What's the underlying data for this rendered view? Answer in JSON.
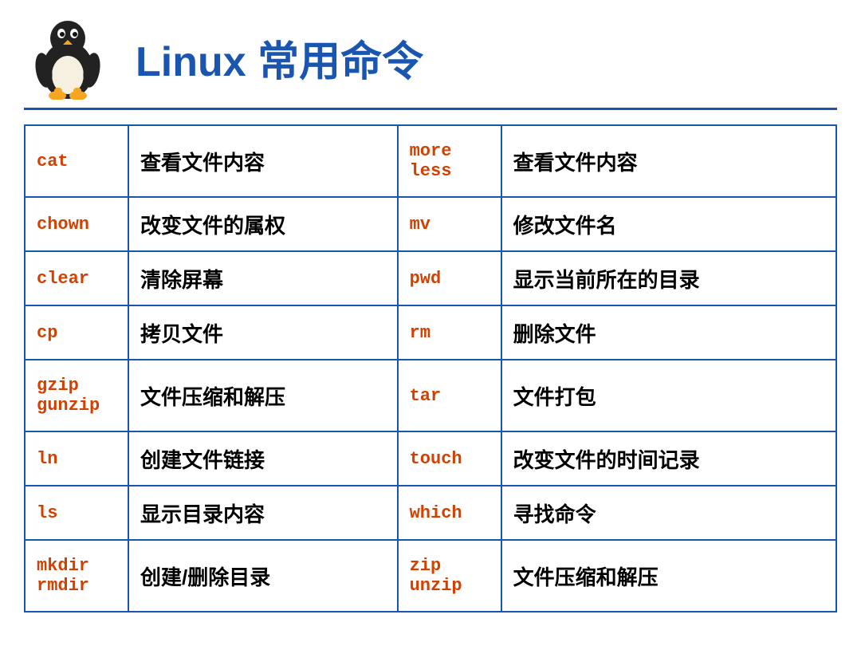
{
  "header": {
    "title": "Linux 常用命令"
  },
  "rows": [
    {
      "cmd1": "cat",
      "desc1": "查看文件内容",
      "cmd2": "more\nless",
      "desc2": "查看文件内容",
      "tall": true
    },
    {
      "cmd1": "chown",
      "desc1": "改变文件的属权",
      "cmd2": "mv",
      "desc2": "修改文件名",
      "tall": false
    },
    {
      "cmd1": "clear",
      "desc1": "清除屏幕",
      "cmd2": "pwd",
      "desc2": "显示当前所在的目录",
      "tall": false
    },
    {
      "cmd1": "cp",
      "desc1": "拷贝文件",
      "cmd2": "rm",
      "desc2": "删除文件",
      "tall": false
    },
    {
      "cmd1": "gzip\ngunzip",
      "desc1": "文件压缩和解压",
      "cmd2": "tar",
      "desc2": "文件打包",
      "tall": true
    },
    {
      "cmd1": "ln",
      "desc1": "创建文件链接",
      "cmd2": "touch",
      "desc2": "改变文件的时间记录",
      "tall": false
    },
    {
      "cmd1": "ls",
      "desc1": "显示目录内容",
      "cmd2": "which",
      "desc2": "寻找命令",
      "tall": false
    },
    {
      "cmd1": "mkdir\nrmdir",
      "desc1": "创建/删除目录",
      "cmd2": "zip\nunzip",
      "desc2": "文件压缩和解压",
      "tall": true
    }
  ]
}
